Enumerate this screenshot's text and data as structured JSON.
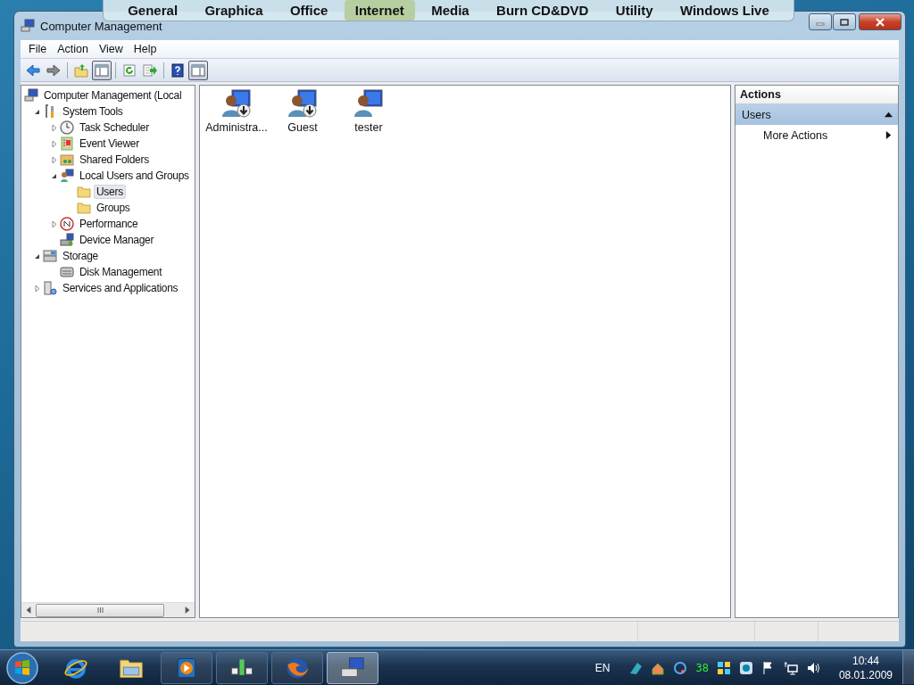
{
  "launcher": {
    "tabs": [
      {
        "label": "General",
        "selected": false
      },
      {
        "label": "Graphica",
        "selected": false
      },
      {
        "label": "Office",
        "selected": false
      },
      {
        "label": "Internet",
        "selected": true
      },
      {
        "label": "Media",
        "selected": false
      },
      {
        "label": "Burn CD&DVD",
        "selected": false
      },
      {
        "label": "Utility",
        "selected": false
      },
      {
        "label": "Windows Live",
        "selected": false
      }
    ]
  },
  "window": {
    "title": "Computer Management"
  },
  "menu": [
    "File",
    "Action",
    "View",
    "Help"
  ],
  "toolbar": [
    {
      "pressed": false
    },
    {
      "pressed": false
    },
    {
      "pressed": false
    },
    {
      "pressed": true
    },
    {
      "pressed": false
    },
    {
      "pressed": false
    },
    {
      "pressed": false
    },
    {
      "pressed": true
    }
  ],
  "tree": [
    {
      "label": "Computer Management (Local",
      "selected": false,
      "children": [
        {
          "label": "System Tools",
          "expanded": true,
          "selected": false,
          "children": [
            {
              "label": "Task Scheduler",
              "expanded": false,
              "selected": false
            },
            {
              "label": "Event Viewer",
              "expanded": false,
              "selected": false
            },
            {
              "label": "Shared Folders",
              "expanded": false,
              "selected": false
            },
            {
              "label": "Local Users and Groups",
              "expanded": true,
              "selected": false,
              "children": [
                {
                  "label": "Users",
                  "selected": true
                },
                {
                  "label": "Groups",
                  "selected": false
                }
              ]
            },
            {
              "label": "Performance",
              "expanded": false,
              "selected": false
            },
            {
              "label": "Device Manager",
              "selected": false
            }
          ]
        },
        {
          "label": "Storage",
          "expanded": true,
          "selected": false,
          "children": [
            {
              "label": "Disk Management",
              "selected": false
            }
          ]
        },
        {
          "label": "Services and Applications",
          "expanded": false,
          "selected": false
        }
      ]
    }
  ],
  "users": [
    {
      "name": "Administra...",
      "disabled": true
    },
    {
      "name": "Guest",
      "disabled": true
    },
    {
      "name": "tester",
      "disabled": false
    }
  ],
  "actions": {
    "title": "Actions",
    "section": {
      "label": "Users",
      "expanded": true
    },
    "items": [
      {
        "label": "More Actions"
      }
    ]
  },
  "taskbar": {
    "apps": [
      {
        "running": false,
        "selected": false
      },
      {
        "running": false,
        "selected": false
      },
      {
        "running": true,
        "selected": false
      },
      {
        "running": true,
        "selected": false
      },
      {
        "running": true,
        "selected": false
      },
      {
        "running": true,
        "selected": true
      }
    ],
    "language": "EN",
    "counter": "38",
    "time": "10:44",
    "date": "08.01.2009"
  }
}
